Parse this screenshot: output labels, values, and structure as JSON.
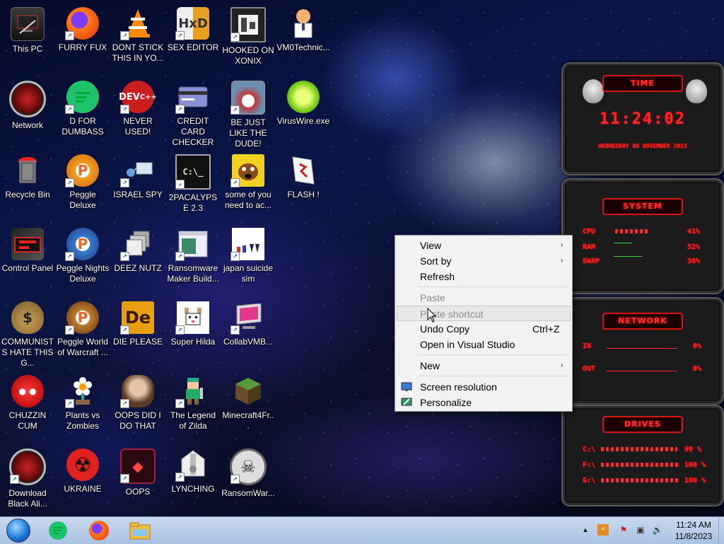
{
  "desktop": {
    "icons": [
      {
        "label": "This PC"
      },
      {
        "label": "FURRY FUX"
      },
      {
        "label": "DONT STICK THIS IN YO..."
      },
      {
        "label": "SEX EDITOR"
      },
      {
        "label": "HOOKED ON XONIX"
      },
      {
        "label": "VM0Technic..."
      },
      {
        "label": "Network"
      },
      {
        "label": "D FOR DUMBASS"
      },
      {
        "label": "NEVER USED!"
      },
      {
        "label": "CREDIT CARD CHECKER"
      },
      {
        "label": "BE JUST LIKE THE DUDE!"
      },
      {
        "label": "VirusWire.exe"
      },
      {
        "label": "Recycle Bin"
      },
      {
        "label": "Peggle Deluxe"
      },
      {
        "label": "ISRAEL SPY"
      },
      {
        "label": "2PACALYPSE 2.3"
      },
      {
        "label": "some of you need to ac..."
      },
      {
        "label": "FLASH !"
      },
      {
        "label": "Control Panel"
      },
      {
        "label": "Peggle Nights Deluxe"
      },
      {
        "label": "DEEZ NUTZ"
      },
      {
        "label": "Ransomware Maker Build..."
      },
      {
        "label": "japan suicide sim"
      },
      {
        "label": "COMMUNISTS HATE THIS G..."
      },
      {
        "label": "Peggle World of Warcraft ..."
      },
      {
        "label": "DIE PLEASE"
      },
      {
        "label": "Super Hilda"
      },
      {
        "label": "CollabVMB..."
      },
      {
        "label": "CHUZZIN CUM"
      },
      {
        "label": "Plants vs Zombies"
      },
      {
        "label": "OOPS DID I DO THAT"
      },
      {
        "label": "The Legend of Zilda"
      },
      {
        "label": "Minecraft4Fr..."
      },
      {
        "label": "Download Black Ali..."
      },
      {
        "label": "UKRAINE"
      },
      {
        "label": "OOPS"
      },
      {
        "label": "LYNCHING"
      },
      {
        "label": "RansomWar..."
      }
    ]
  },
  "context_menu": {
    "view": "View",
    "sort_by": "Sort by",
    "refresh": "Refresh",
    "paste": "Paste",
    "paste_shortcut": "Paste shortcut",
    "undo_copy": "Undo Copy",
    "undo_copy_shortcut": "Ctrl+Z",
    "open_vs": "Open in Visual Studio",
    "new": "New",
    "screen_resolution": "Screen resolution",
    "personalize": "Personalize",
    "submenu_arrow": "›"
  },
  "gadgets": {
    "time": {
      "header": "TIME",
      "clock": "11:24:02",
      "date": "WEDNESDAY 08 NOVEMBER 2023"
    },
    "system": {
      "header": "SYSTEM",
      "rows": [
        {
          "label": "CPU",
          "value": "41%",
          "level": 0.41
        },
        {
          "label": "RAM",
          "value": "52%",
          "level": 0.52
        },
        {
          "label": "SWAP",
          "value": "36%",
          "level": 0.36
        }
      ]
    },
    "network": {
      "header": "NETWORK",
      "rows": [
        {
          "label": "IN",
          "value": "0%"
        },
        {
          "label": "OUT",
          "value": "0%"
        }
      ]
    },
    "drives": {
      "header": "DRIVES",
      "rows": [
        {
          "label": "C:\\",
          "value": "99 %",
          "level": 0.99
        },
        {
          "label": "F:\\",
          "value": "100 %",
          "level": 1.0
        },
        {
          "label": "G:\\",
          "value": "100 %",
          "level": 1.0
        }
      ]
    }
  },
  "taskbar": {
    "clock_time": "11:24 AM",
    "clock_date": "11/8/2023",
    "tray_expand": "▲"
  },
  "colors": {
    "gadget_red": "#ff2424",
    "taskbar_top": "#c9d9ee",
    "menu_bg": "#f2f2f2"
  }
}
